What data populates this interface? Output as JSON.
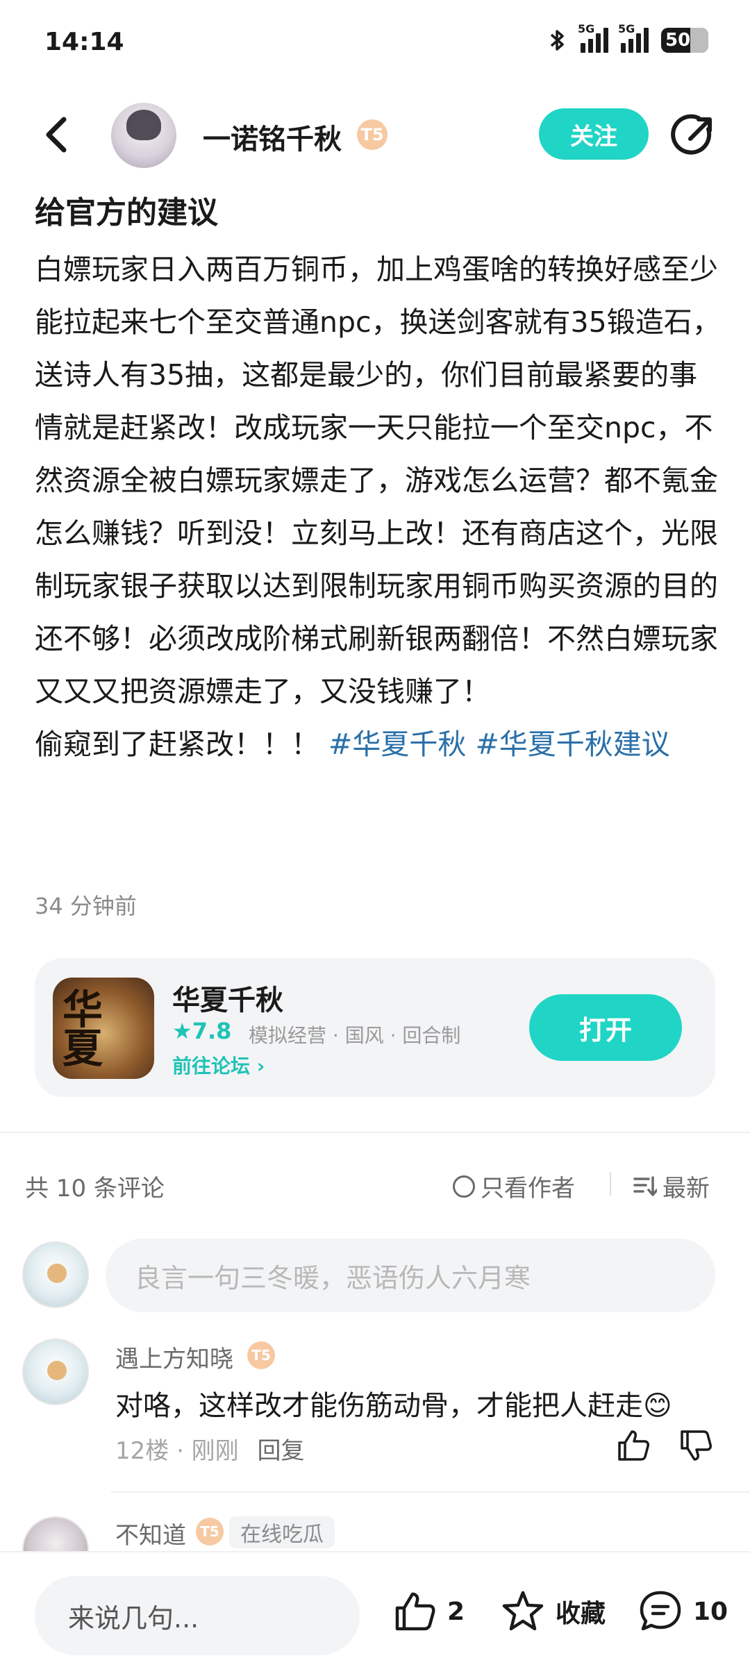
{
  "status_bar": {
    "time": "14:14",
    "battery": "50",
    "net1": "5G",
    "net2": "5G"
  },
  "header": {
    "author_name": "一诺铭千秋",
    "level_badge": "T5",
    "follow_label": "关注"
  },
  "post": {
    "title": "给官方的建议",
    "body": "白嫖玩家日入两百万铜币，加上鸡蛋啥的转换好感至少能拉起来七个至交普通npc，换送剑客就有35锻造石，送诗人有35抽，这都是最少的，你们目前最紧要的事情就是赶紧改！改成玩家一天只能拉一个至交npc，不然资源全被白嫖玩家嫖走了，游戏怎么运营？都不氪金怎么赚钱？听到没！立刻马上改！还有商店这个，光限制玩家银子获取以达到限制玩家用铜币购买资源的目的还不够！必须改成阶梯式刷新银两翻倍！不然白嫖玩家又又又把资源嫖走了，又没钱赚了！",
    "body_end": "偷窥到了赶紧改！！！",
    "tags": [
      "#华夏千秋",
      "#华夏千秋建议"
    ],
    "time": "34 分钟前"
  },
  "game_card": {
    "icon_text": "华夏",
    "name": "华夏千秋",
    "rating": "★7.8",
    "tags": "模拟经营 · 国风 · 回合制",
    "forum_link": "前往论坛 ›",
    "open_label": "打开"
  },
  "comments": {
    "count_label": "共 10 条评论",
    "author_only_label": "只看作者",
    "sort_label": "最新",
    "input_placeholder": "良言一句三冬暖，恶语伤人六月寒",
    "items": [
      {
        "user": "遇上方知晓",
        "badge": "T5",
        "text": "对咯，这样改才能伤筋动骨，才能把人赶走😊",
        "meta": "12楼 · 刚刚",
        "reply": "回复"
      },
      {
        "user": "不知道",
        "badge": "T5",
        "tag": "在线吃瓜"
      }
    ]
  },
  "bottom_bar": {
    "placeholder": "来说几句...",
    "likes": "2",
    "collect_label": "收藏",
    "comments": "10"
  },
  "colors": {
    "accent": "#20d5c6",
    "tag_link": "#2a6fa8",
    "badge": "#f7c9a2"
  }
}
